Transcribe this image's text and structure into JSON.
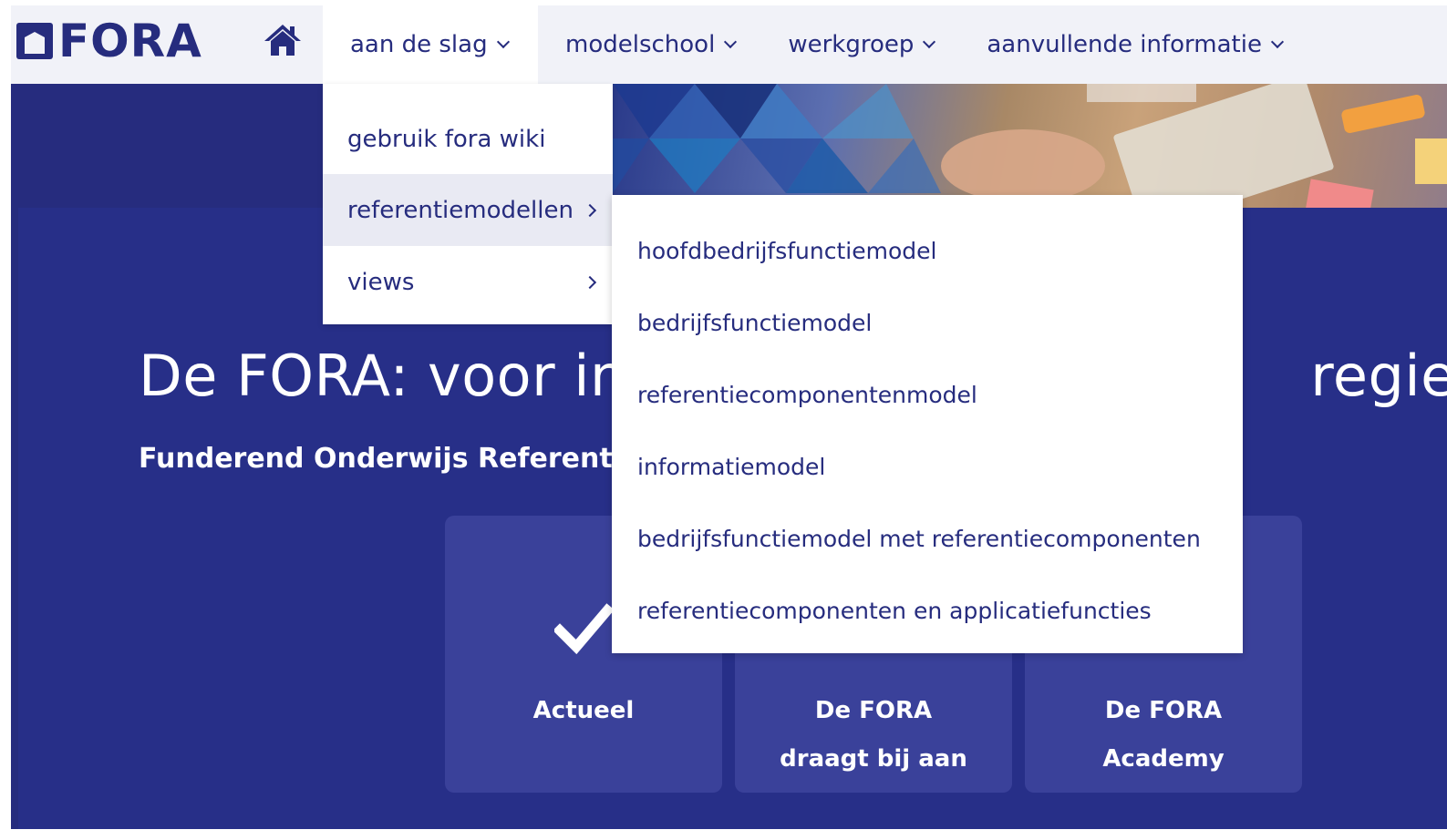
{
  "brand": {
    "logo_text": "FORA"
  },
  "nav": {
    "items": [
      {
        "label": "aan de slag"
      },
      {
        "label": "modelschool"
      },
      {
        "label": "werkgroep"
      },
      {
        "label": "aanvullende informatie"
      }
    ]
  },
  "dropdown": {
    "items": [
      {
        "label": "gebruik fora wiki"
      },
      {
        "label": "referentiemodellen"
      },
      {
        "label": "views"
      }
    ]
  },
  "submenu": {
    "items": [
      {
        "label": "hoofdbedrijfsfunctiemodel"
      },
      {
        "label": "bedrijfsfunctiemodel"
      },
      {
        "label": "referentiecomponentenmodel"
      },
      {
        "label": "informatiemodel"
      },
      {
        "label": "bedrijfsfunctiemodel met referentiecomponenten"
      },
      {
        "label": "referentiecomponenten en applicatiefuncties"
      }
    ]
  },
  "hero": {
    "title_left": "De FORA: voor in",
    "title_right": "regie o",
    "subtitle": "Funderend Onderwijs Referentie"
  },
  "tiles": [
    {
      "label_line1": "Actueel",
      "label_line2": "",
      "icon": "checkmark-icon"
    },
    {
      "label_line1": "De FORA",
      "label_line2": "draagt bij aan",
      "icon": "tile-icon"
    },
    {
      "label_line1": "De FORA",
      "label_line2": "Academy",
      "icon": "tile-icon"
    }
  ],
  "colors": {
    "brand_navy": "#262c7e",
    "nav_background": "#f1f2f8",
    "hero_background": "#272f88",
    "tile_background": "#3a419a",
    "hover_background": "#e9eaf3"
  }
}
